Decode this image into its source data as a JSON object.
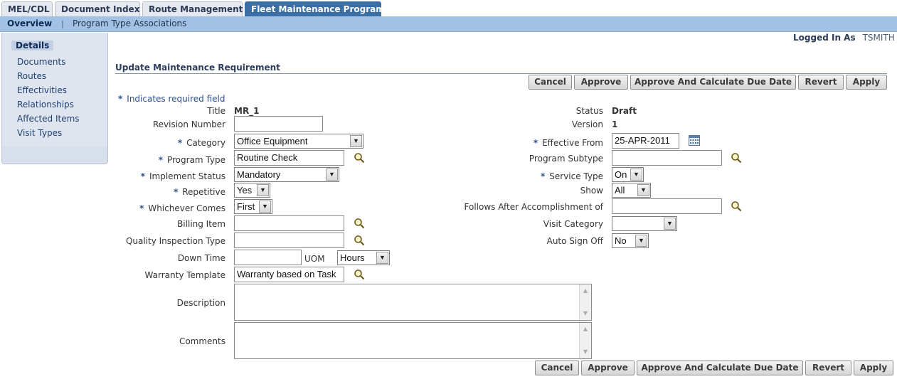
{
  "tabs": [
    {
      "label": "MEL/CDL"
    },
    {
      "label": "Document Index"
    },
    {
      "label": "Route Management"
    },
    {
      "label": "Fleet Maintenance Program"
    }
  ],
  "subnav": {
    "overview": "Overview",
    "separator": "|",
    "program_type_associations": "Program Type Associations"
  },
  "sidebar": {
    "items": [
      {
        "label": "Details"
      },
      {
        "label": "Documents"
      },
      {
        "label": "Routes"
      },
      {
        "label": "Effectivities"
      },
      {
        "label": "Relationships"
      },
      {
        "label": "Affected Items"
      },
      {
        "label": "Visit Types"
      }
    ]
  },
  "user": {
    "logged_in_label": "Logged In As",
    "name": "TSMITH"
  },
  "page": {
    "title": "Update Maintenance Requirement",
    "required_note": "Indicates required field",
    "required_mark": "*"
  },
  "buttons": {
    "cancel": "Cancel",
    "approve": "Approve",
    "approve_calc": "Approve And Calculate Due Date",
    "revert": "Revert",
    "apply": "Apply"
  },
  "form": {
    "title": {
      "label": "Title",
      "value": "MR_1"
    },
    "revision_number": {
      "label": "Revision Number",
      "value": ""
    },
    "category": {
      "label": "Category",
      "value": "Office Equipment"
    },
    "program_type": {
      "label": "Program Type",
      "value": "Routine Check"
    },
    "implement_status": {
      "label": "Implement Status",
      "value": "Mandatory"
    },
    "repetitive": {
      "label": "Repetitive",
      "value": "Yes"
    },
    "whichever_comes": {
      "label": "Whichever Comes",
      "value": "First"
    },
    "billing_item": {
      "label": "Billing Item",
      "value": ""
    },
    "quality_inspection_type": {
      "label": "Quality Inspection Type",
      "value": ""
    },
    "down_time": {
      "label": "Down Time",
      "value": "",
      "uom_label": "UOM",
      "uom_value": "Hours"
    },
    "warranty_template": {
      "label": "Warranty Template",
      "value": "Warranty based on Task"
    },
    "description": {
      "label": "Description",
      "value": ""
    },
    "comments": {
      "label": "Comments",
      "value": ""
    },
    "status": {
      "label": "Status",
      "value": "Draft"
    },
    "version": {
      "label": "Version",
      "value": "1"
    },
    "effective_from": {
      "label": "Effective From",
      "value": "25-APR-2011"
    },
    "program_subtype": {
      "label": "Program Subtype",
      "value": ""
    },
    "service_type": {
      "label": "Service Type",
      "value": "On"
    },
    "show": {
      "label": "Show",
      "value": "All"
    },
    "follows_after": {
      "label": "Follows After Accomplishment of",
      "value": ""
    },
    "visit_category": {
      "label": "Visit Category",
      "value": ""
    },
    "auto_sign_off": {
      "label": "Auto Sign Off",
      "value": "No"
    }
  },
  "colors": {
    "active_tab": "#3a6ea5",
    "subnav": "#a3c2e3",
    "sidebar": "#dfe5ef",
    "required": "#2d4f8a"
  },
  "icons": [
    "search-icon",
    "calendar-icon",
    "dropdown-arrow-icon"
  ]
}
